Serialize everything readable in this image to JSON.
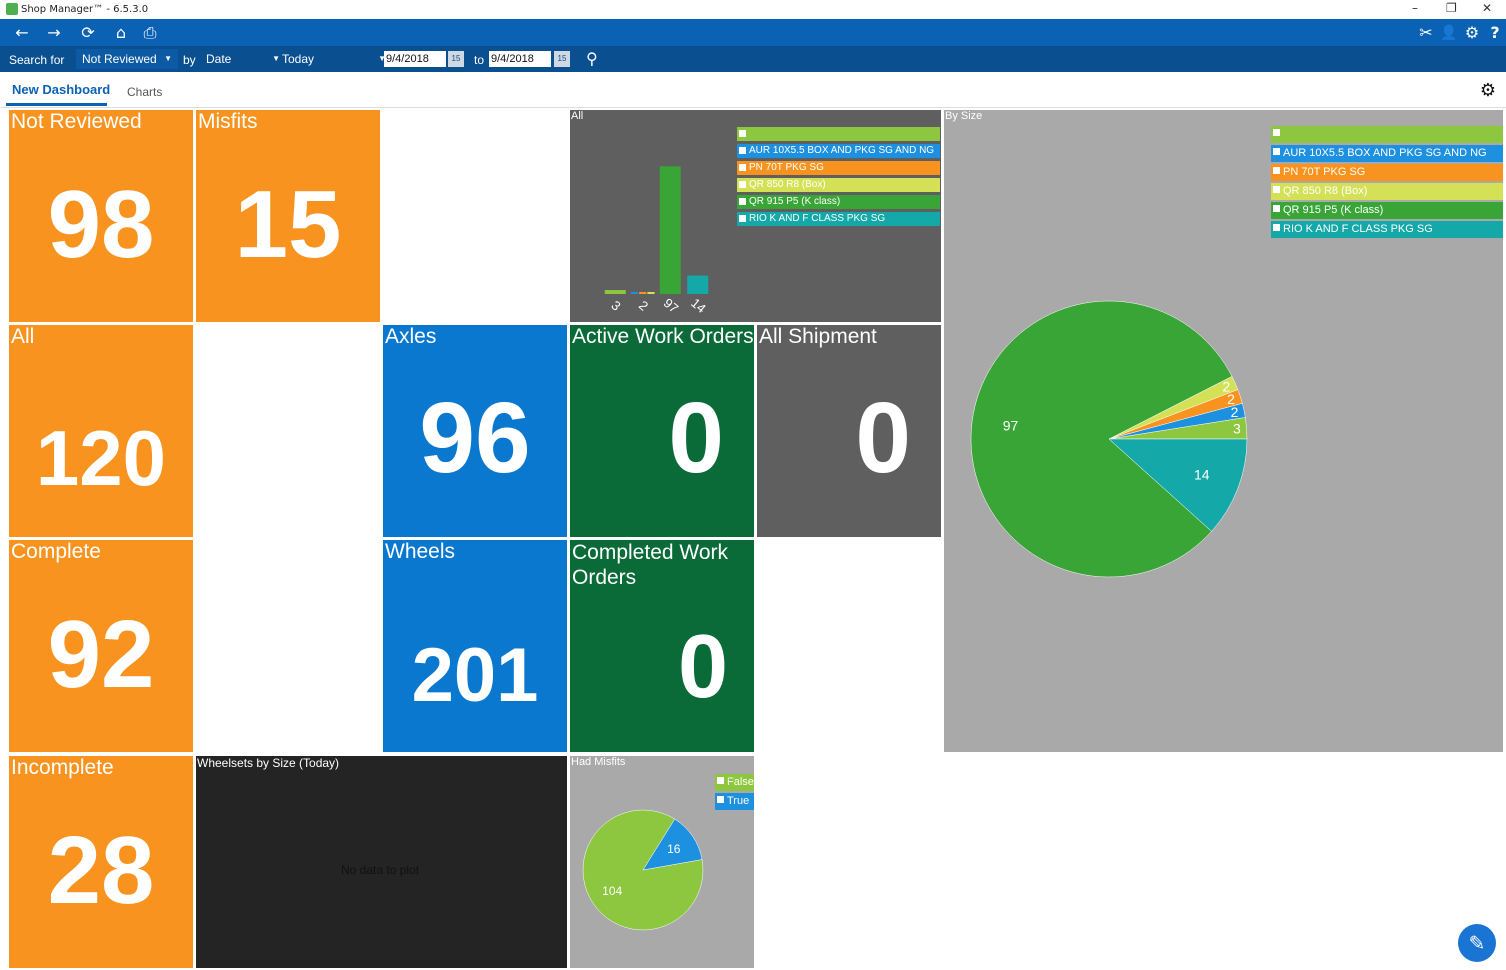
{
  "window": {
    "title": "Shop Manager™ - 6.5.3.0",
    "controls": {
      "minimize": "–",
      "restore": "❐",
      "close": "✕"
    }
  },
  "toolbar": {
    "back_icon": "←",
    "forward_icon": "→",
    "refresh_icon": "⟳",
    "home_icon": "⌂",
    "print_icon": "⎙",
    "tools_icon": "✂",
    "user_icon": "👤",
    "settings_icon": "⚙",
    "help_icon": "?"
  },
  "search": {
    "search_for_label": "Search for",
    "filter_value": "Not Reviewed",
    "by_label": "by",
    "by_value": "Date",
    "range_value": "Today",
    "date_from": "9/4/2018",
    "to_label": "to",
    "date_to": "9/4/2018",
    "calendar_icon": "15",
    "go_icon": "⚲"
  },
  "tabs": [
    {
      "label": "New Dashboard"
    },
    {
      "label": "Charts"
    }
  ],
  "settings_gear": "⚙",
  "tiles": {
    "not_reviewed": {
      "label": "Not Reviewed",
      "value": "98"
    },
    "misfits": {
      "label": "Misfits",
      "value": "15"
    },
    "all": {
      "label": "All",
      "value": "120"
    },
    "axles": {
      "label": "Axles",
      "value": "96"
    },
    "active_work_orders": {
      "label": "Active Work Orders",
      "value": "0"
    },
    "all_shipment": {
      "label": "All Shipment",
      "value": "0"
    },
    "complete": {
      "label": "Complete",
      "value": "92"
    },
    "wheels": {
      "label": "Wheels",
      "value": "201"
    },
    "completed_work_orders": {
      "label": "Completed Work Orders",
      "value": "0"
    },
    "incomplete": {
      "label": "Incomplete",
      "value": "28"
    },
    "wheelsets_by_size": {
      "label": "Wheelsets by Size (Today)",
      "empty_text": "No data to plot"
    }
  },
  "colors": {
    "orange": "#f7931e",
    "blue": "#0b78d0",
    "green": "#0a6a38",
    "gray": "#5f5f5f"
  },
  "chart_data": [
    {
      "type": "bar",
      "title": "All",
      "categories": [
        "3",
        "2",
        "97",
        "14"
      ],
      "ylim": [
        0,
        120
      ],
      "yticks": [
        0,
        20,
        40,
        60,
        80,
        100,
        120
      ],
      "series": [
        {
          "name": "",
          "color": "#8dc63f",
          "values": [
            3,
            0,
            0,
            0
          ]
        },
        {
          "name": "AUR 10X5.5 BOX AND PKG   SG AND NG",
          "color": "#1e90e0",
          "values": [
            0,
            1,
            0,
            0
          ]
        },
        {
          "name": "PN 70T PKG SG",
          "color": "#f7931e",
          "values": [
            0,
            1,
            0,
            0
          ]
        },
        {
          "name": "QR 850 R8 (Box)",
          "color": "#d4e157",
          "values": [
            0,
            1,
            0,
            0
          ]
        },
        {
          "name": "QR 915 P5 (K class)",
          "color": "#3aa537",
          "values": [
            0,
            0,
            97,
            0
          ]
        },
        {
          "name": "RIO K AND F CLASS PKG SG",
          "color": "#14a8a8",
          "values": [
            0,
            0,
            0,
            14
          ]
        }
      ],
      "legend": "top-right"
    },
    {
      "type": "pie",
      "title": "By Size",
      "slices": [
        {
          "name": "",
          "value": 3,
          "color": "#8dc63f"
        },
        {
          "name": "AUR 10X5.5 BOX AND PKG   SG AND NG",
          "value": 2,
          "color": "#1e90e0"
        },
        {
          "name": "PN 70T PKG SG",
          "value": 2,
          "color": "#f7931e"
        },
        {
          "name": "QR 850 R8 (Box)",
          "value": 2,
          "color": "#d4e157"
        },
        {
          "name": "QR 915 P5 (K class)",
          "value": 97,
          "color": "#3aa537"
        },
        {
          "name": "RIO K AND F CLASS PKG SG",
          "value": 14,
          "color": "#14a8a8"
        }
      ],
      "legend": "top-right"
    },
    {
      "type": "pie",
      "title": "Had Misfits",
      "slices": [
        {
          "name": "False",
          "value": 104,
          "color": "#8dc63f"
        },
        {
          "name": "True",
          "value": 16,
          "color": "#1e90e0"
        }
      ],
      "legend": "top-right"
    }
  ],
  "fab": {
    "icon": "✎"
  }
}
